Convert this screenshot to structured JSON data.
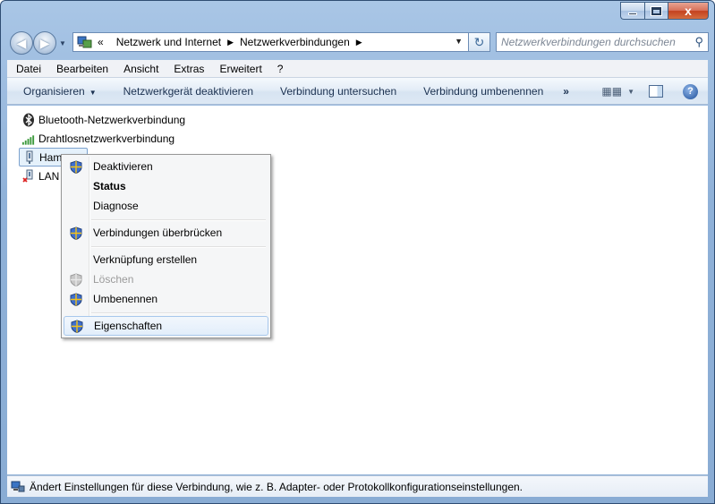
{
  "window": {
    "caption_buttons": {
      "minimize": "",
      "maximize": "",
      "close": "x"
    }
  },
  "navigation": {
    "breadcrumb_overflow": "«",
    "breadcrumbs": [
      "Netzwerk und Internet",
      "Netzwerkverbindungen"
    ],
    "search_placeholder": "Netzwerkverbindungen durchsuchen"
  },
  "menubar": {
    "items": [
      "Datei",
      "Bearbeiten",
      "Ansicht",
      "Extras",
      "Erweitert",
      "?"
    ]
  },
  "commandbar": {
    "organize": "Organisieren",
    "disable": "Netzwerkgerät deaktivieren",
    "diagnose": "Verbindung untersuchen",
    "rename": "Verbindung umbenennen",
    "more": "»"
  },
  "connections": [
    {
      "label": "Bluetooth-Netzwerkverbindung",
      "icon": "bluetooth-icon"
    },
    {
      "label": "Drahtlosnetzwerkverbindung",
      "icon": "wireless-signal-icon"
    },
    {
      "label": "Ham",
      "icon": "network-adapter-icon",
      "selected": true
    },
    {
      "label": "LAN",
      "icon": "network-adapter-disconnected-icon"
    }
  ],
  "context_menu": {
    "items": [
      {
        "label": "Deaktivieren",
        "icon": "uac-shield-icon"
      },
      {
        "label": "Status",
        "bold": true
      },
      {
        "label": "Diagnose"
      },
      {
        "label": "Verbindungen überbrücken",
        "icon": "uac-shield-icon"
      },
      {
        "label": "Verknüpfung erstellen"
      },
      {
        "label": "Löschen",
        "icon": "uac-shield-icon",
        "disabled": true
      },
      {
        "label": "Umbenennen",
        "icon": "uac-shield-icon"
      },
      {
        "label": "Eigenschaften",
        "icon": "uac-shield-icon",
        "highlighted": true
      }
    ]
  },
  "status_bar": {
    "text": "Ändert Einstellungen für diese Verbindung, wie z. B. Adapter- oder Protokollkonfigurationseinstellungen."
  },
  "colors": {
    "frame": "#a9c6e6",
    "command_bar": "#dde8f4",
    "highlight": "#e2eefb",
    "close_button": "#c4411f"
  }
}
